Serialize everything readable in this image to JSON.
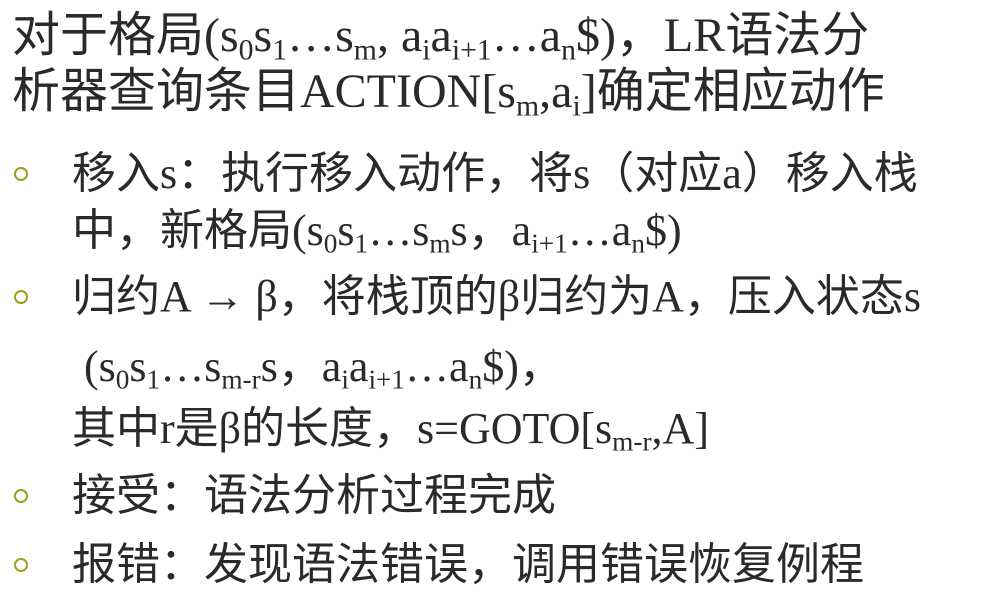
{
  "intro": {
    "line1": {
      "lead": "对于格局(s",
      "s0": "0",
      "s1": "s",
      "s1i": "1",
      "dots1": "…s",
      "sm": "m",
      "comma": ", a",
      "ai": "i",
      "a2": "a",
      "ai1": "i+1",
      "dots2": "…a",
      "an": "n",
      "tail": "$)，LR语法分"
    },
    "line2": {
      "lead": "析器查询条目ACTION[s",
      "sm": "m",
      "comma": ",a",
      "ai": "i",
      "tail": "]确定相应动作"
    }
  },
  "items": [
    {
      "line1": "移入s：执行移入动作，将s（对应a）移入栈",
      "line2": {
        "lead": "中，新格局(s",
        "s0": "0",
        "s1": "s",
        "s1i": "1",
        "dots1": "…s",
        "sm": "m",
        "mid": "s，a",
        "ai1": "i+1",
        "dots2": "…a",
        "an": "n",
        "tail": "$)"
      }
    },
    {
      "line1": "归约A → β，将栈顶的β归约为A，压入状态s",
      "line2": {
        "lead": "(s",
        "s0": "0",
        "s1": "s",
        "s1i": "1",
        "dots1": "…s",
        "smr": "m-r",
        "mid": "s，a",
        "ai": "i",
        "a2": "a",
        "ai1": "i+1",
        "dots2": "…a",
        "an": "n",
        "tail": "$)，"
      },
      "line3": {
        "lead": "其中r是β的长度，s=GOTO[s",
        "smr": "m-r",
        "tail": ",A]"
      }
    },
    {
      "line1": "接受：语法分析过程完成"
    },
    {
      "line1": "报错：发现语法错误，调用错误恢复例程"
    }
  ]
}
